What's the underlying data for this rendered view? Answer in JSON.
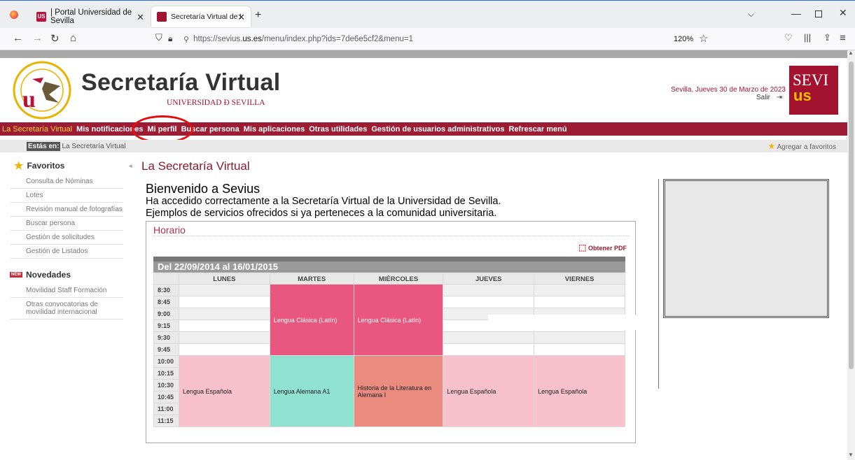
{
  "browser": {
    "tabs": [
      {
        "title": "| Portal Universidad de Sevilla",
        "favicon_text": "US"
      },
      {
        "title": "Secretaría Virtual de la Universid"
      }
    ],
    "url_prefix": "https://sevius.",
    "url_host": "us.es",
    "url_path": "/menu/index.php?ids=7de6e5cf2&menu=1",
    "zoom": "120%"
  },
  "header": {
    "title": "Secretaría Virtual",
    "subtitle": "UNIVERSIDAD Ð SEVILLA",
    "date": "Sevilla, Jueves 30 de Marzo de 2023",
    "logout": "Salir",
    "logo_text": "SEVI",
    "logo_sub": "us"
  },
  "menu": {
    "items": [
      "La Secretaría Virtual",
      "Mis notificaciones",
      "Mi perfil",
      "Buscar persona",
      "Mis aplicaciones",
      "Otras utilidades",
      "Gestión de usuarios administrativos",
      "Refrescar menú"
    ]
  },
  "breadcrumb": {
    "label": "Estás en:",
    "current": "La Secretaría Virtual",
    "favorites_link": "Agregar a favoritos"
  },
  "sidebar": {
    "favoritos_title": "Favoritos",
    "favoritos": [
      "Consulta de Nóminas",
      "Lotes",
      "Revisión manual de fotografías",
      "Buscar persona",
      "Gestión de solicitudes",
      "Gestión de Listados"
    ],
    "novedades_title": "Novedades",
    "novedades_badge": "NEW",
    "novedades": [
      "Movilidad Staff Formación",
      "Otras convocatorias de movilidad internacional"
    ]
  },
  "main": {
    "section_title": "La Secretaría Virtual",
    "welcome": "Bienvenido a Sevius",
    "line1": "Ha accedido correctamente a la Secretaría Virtual de la Universidad de Sevilla.",
    "line2": "Ejemplos de servicios ofrecidos si ya perteneces a la comunidad universitaria.",
    "horario_title": "Horario",
    "pdf_link": "Obtener PDF",
    "period": "Del 22/09/2014 al 16/01/2015",
    "days": [
      "LUNES",
      "MARTES",
      "MIÉRCOLES",
      "JUEVES",
      "VIERNES"
    ],
    "times": [
      "8:30",
      "8:45",
      "9:00",
      "9:15",
      "9:30",
      "9:45",
      "10:00",
      "10:15",
      "10:30",
      "10:45",
      "11:00",
      "11:15"
    ],
    "classes": {
      "martes_am": "Lengua Clásica (Latín)",
      "miercoles_am": "Lengua Clásica (Latín)",
      "lunes_pm": "Lengua Española",
      "martes_pm": "Lengua Alemana A1",
      "miercoles_pm": "Historia de la Literatura en Alemana I",
      "jueves_pm": "Lengua Española",
      "viernes_pm": "Lengua Española"
    }
  },
  "colors": {
    "brand": "#9c1c34",
    "menu_highlight": "#ffd23f",
    "annotation": "#e01010"
  }
}
